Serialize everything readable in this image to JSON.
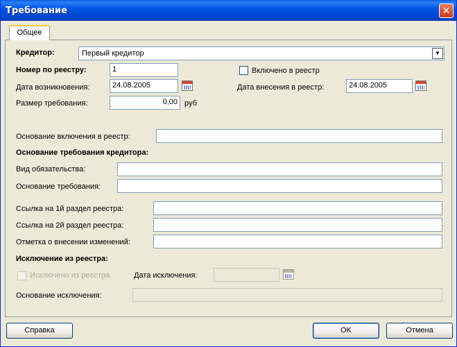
{
  "window": {
    "title": "Требование"
  },
  "tabs": [
    {
      "label": "Общее"
    }
  ],
  "creditor": {
    "label": "Кредитор:",
    "value": "Первый кредитор"
  },
  "registry_number": {
    "label": "Номер по реестру:",
    "value": "1"
  },
  "included_in_registry": {
    "label": "Включено в реестр",
    "checked": false
  },
  "origin_date": {
    "label": "Дата возникновения:",
    "value": "24.08.2005"
  },
  "entry_date": {
    "label": "Дата внесения в реестр:",
    "value": "24.08.2005"
  },
  "claim_amount": {
    "label": "Размер требования:",
    "value": "0,00",
    "unit": "руб"
  },
  "inclusion_basis": {
    "label": "Основание включения в реестр:",
    "value": ""
  },
  "claim_basis_section": {
    "heading": "Основание требования кредитора:"
  },
  "obligation_type": {
    "label": "Вид обязательства:",
    "value": ""
  },
  "claim_basis": {
    "label": "Основание требования:",
    "value": ""
  },
  "registry_section_1_ref": {
    "label": "Ссылка на 1й раздел реестра:",
    "value": ""
  },
  "registry_section_2_ref": {
    "label": "Ссылка на 2й раздел реестра:",
    "value": ""
  },
  "changes_note": {
    "label": "Отметка о внесении изменений:",
    "value": ""
  },
  "exclusion_section": {
    "heading": "Исключение из реестра:"
  },
  "excluded_from_registry": {
    "label": "Исключено из реестра",
    "checked": false,
    "enabled": false
  },
  "exclusion_date": {
    "label": "Дата исключения:",
    "value": ""
  },
  "exclusion_basis": {
    "label": "Основание исключения:",
    "value": ""
  },
  "buttons": {
    "help": "Справка",
    "ok": "OK",
    "cancel": "Отмена"
  },
  "icons": {
    "close": "close-icon",
    "calendar": "calendar-icon",
    "dropdown": "chevron-down-icon"
  }
}
